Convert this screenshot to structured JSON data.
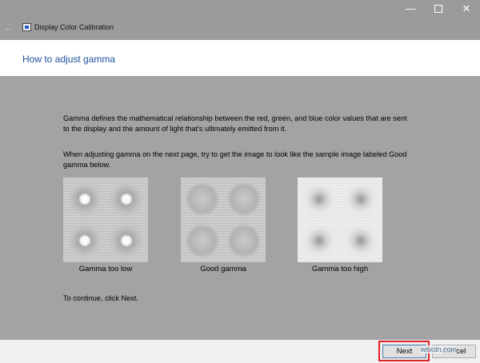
{
  "window": {
    "title": "Display Color Calibration",
    "minimize": "—",
    "close": "✕",
    "back": "←"
  },
  "header": {
    "title": "How to adjust gamma"
  },
  "content": {
    "para1": "Gamma defines the mathematical relationship between the red, green, and blue color values that are sent to the display and the amount of light that's ultimately emitted from it.",
    "para2": "When adjusting gamma on the next page, try to get the image to look like the sample image labeled Good gamma below.",
    "samples": [
      {
        "caption": "Gamma too low"
      },
      {
        "caption": "Good gamma"
      },
      {
        "caption": "Gamma too high"
      }
    ],
    "para3": "To continue, click Next."
  },
  "footer": {
    "next_label": "Next",
    "cancel_label": "Cancel"
  },
  "watermark": "wsxdn.com",
  "colors": {
    "title_blue": "#1e4f9c",
    "highlight_red": "#e0202a"
  }
}
